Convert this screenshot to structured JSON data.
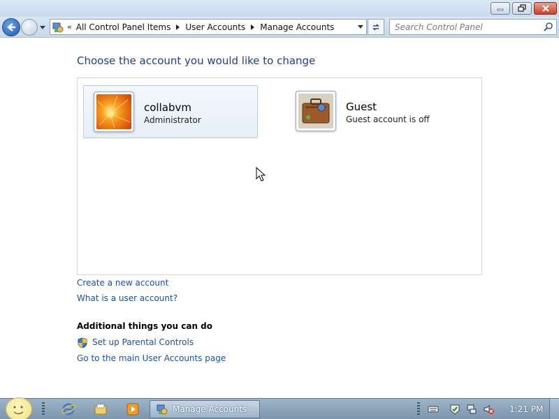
{
  "window": {
    "minimize_label": "Minimize",
    "maximize_label": "Restore",
    "close_label": "Close"
  },
  "navigation": {
    "breadcrumb_overflow": "«",
    "breadcrumbs": [
      "All Control Panel Items",
      "User Accounts",
      "Manage Accounts"
    ],
    "search_placeholder": "Search Control Panel"
  },
  "content": {
    "heading": "Choose the account you would like to change",
    "accounts": [
      {
        "name": "collabvm",
        "status": "Administrator",
        "picture": "orange-flower",
        "selected": true
      },
      {
        "name": "Guest",
        "status": "Guest account is off",
        "picture": "briefcase",
        "selected": false
      }
    ],
    "links": {
      "create_account": "Create a new account",
      "what_is_account": "What is a user account?"
    },
    "additional_title": "Additional things you can do",
    "additional_links": {
      "parental_controls": "Set up Parental Controls",
      "main_user_accounts": "Go to the main User Accounts page"
    }
  },
  "taskbar": {
    "active_task": "Manage Accounts",
    "clock": "1:21 PM",
    "pinned": [
      "internet-explorer-icon",
      "windows-explorer-icon",
      "media-player-icon"
    ],
    "tray": [
      "keyboard-icon",
      "action-center-icon",
      "network-icon",
      "volume-muted-icon"
    ]
  },
  "colors": {
    "heading": "#1e3f8a",
    "link": "#1b4fa8",
    "taskbar": "#8ba3ba"
  }
}
